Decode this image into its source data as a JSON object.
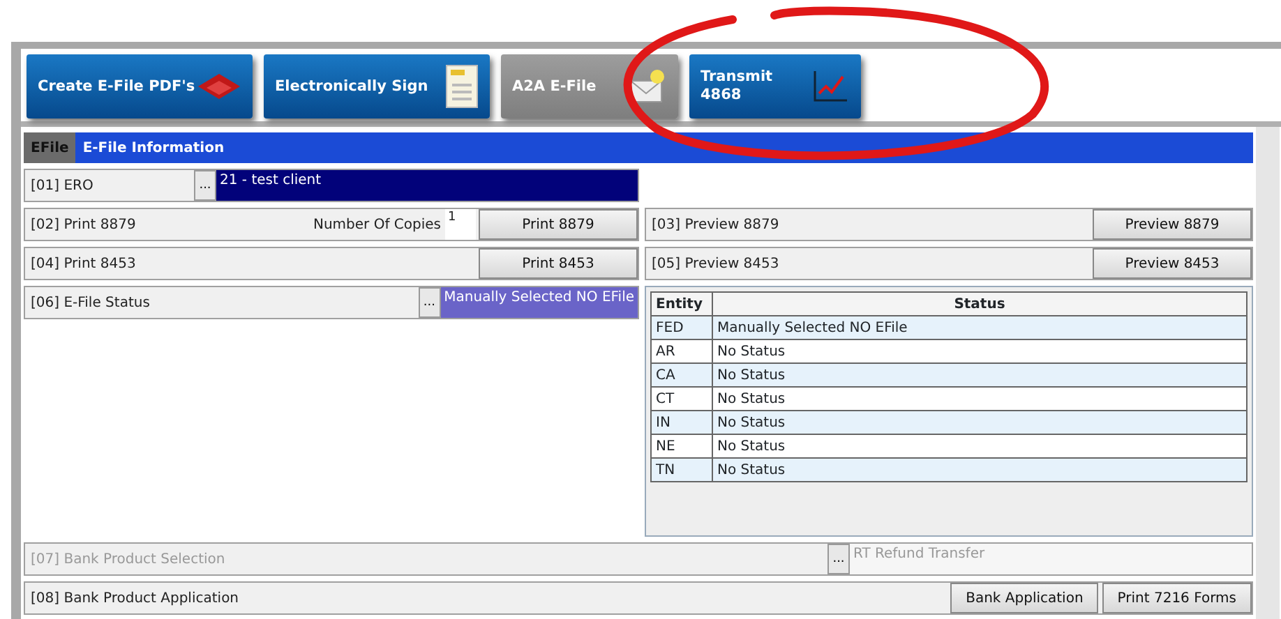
{
  "toolbar": [
    {
      "label": "Create E-File PDF's",
      "kind": "pdf",
      "disabled": false
    },
    {
      "label": "Electronically Sign",
      "kind": "sign",
      "disabled": false
    },
    {
      "label": "A2A E-File",
      "kind": "mail",
      "disabled": true
    },
    {
      "label": "Transmit\n4868",
      "kind": "chart",
      "disabled": false
    }
  ],
  "header": {
    "tab": "EFile",
    "title": "E-File Information"
  },
  "ero": {
    "label": "[01] ERO",
    "browse": "...",
    "value": "21 - test client"
  },
  "print_rows": [
    {
      "label": "[02] Print 8879",
      "copies_label": "Number Of Copies",
      "copies": "1",
      "button": "Print 8879",
      "preview_label": "[03] Preview 8879",
      "preview_button": "Preview 8879"
    },
    {
      "label": "[04] Print 8453",
      "button": "Print 8453",
      "preview_label": "[05] Preview 8453",
      "preview_button": "Preview 8453"
    }
  ],
  "efile_status": {
    "label": "[06] E-File Status",
    "browse": "...",
    "value": "Manually Selected NO EFile"
  },
  "status_table": {
    "columns": [
      "Entity",
      "Status"
    ],
    "rows": [
      [
        "FED",
        "Manually Selected NO EFile"
      ],
      [
        "AR",
        "No Status"
      ],
      [
        "CA",
        "No Status"
      ],
      [
        "CT",
        "No Status"
      ],
      [
        "IN",
        "No Status"
      ],
      [
        "NE",
        "No Status"
      ],
      [
        "TN",
        "No Status"
      ]
    ]
  },
  "bank_selection": {
    "label": "[07] Bank Product Selection",
    "browse": "...",
    "value": "RT Refund Transfer",
    "disabled": true
  },
  "bank_application": {
    "label": "[08] Bank Product Application",
    "buttons": [
      "Bank Application",
      "Print 7216 Forms"
    ]
  }
}
